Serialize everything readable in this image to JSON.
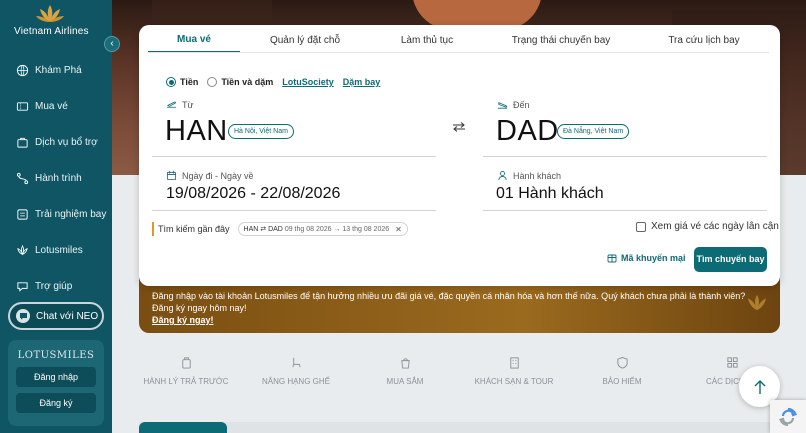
{
  "brand": {
    "name": "Vietnam Airlines",
    "color": "#0f5563",
    "accent": "#0d6b75",
    "gold": "#d79a2b"
  },
  "sidebar": {
    "items": [
      {
        "label": "Khám Phá",
        "icon": "globe-icon"
      },
      {
        "label": "Mua vé",
        "icon": "ticket-icon"
      },
      {
        "label": "Dịch vụ bổ trợ",
        "icon": "services-icon"
      },
      {
        "label": "Hành trình",
        "icon": "route-icon"
      },
      {
        "label": "Trải nghiệm bay",
        "icon": "experience-icon"
      },
      {
        "label": "Lotusmiles",
        "icon": "lotus-icon"
      },
      {
        "label": "Trợ giúp",
        "icon": "help-icon"
      }
    ],
    "chat_label": "Chat với NEO",
    "lotusmiles": {
      "title": "LOTUSMILES",
      "login": "Đăng nhập",
      "register": "Đăng ký"
    }
  },
  "tabs": [
    "Mua vé",
    "Quản lý đặt chỗ",
    "Làm thủ tục",
    "Trạng thái chuyến bay",
    "Tra cứu lịch bay"
  ],
  "options": {
    "cash": "Tiền",
    "cash_miles": "Tiền và dặm",
    "lotus_society": "LotuSociety",
    "miles": "Dặm bay"
  },
  "from": {
    "label": "Từ",
    "code": "HAN",
    "city": "Hà Nội, Việt Nam"
  },
  "to": {
    "label": "Đến",
    "code": "DAD",
    "city": "Đà Nẵng, Việt Nam"
  },
  "dates": {
    "label": "Ngày đi - Ngày về",
    "value": "19/08/2026 - 22/08/2026"
  },
  "passengers": {
    "label": "Hành khách",
    "value": "01 Hành khách"
  },
  "recent": {
    "label": "Tìm kiếm gần đây",
    "chip_route": "HAN ⇄ DAD",
    "chip_dates": "09 thg 08 2026 → 13 thg 08 2026"
  },
  "flex_dates": "Xem giá vé các ngày lân cận",
  "promo": "Mã khuyến mại",
  "search": "Tìm chuyến bay",
  "banner": {
    "message": "Đăng nhập vào tài khoản Lotusmiles để tận hưởng nhiều ưu đãi giá vé, đặc quyền cá nhân hóa và hơn thế nữa. Quý khách chưa phải là thành viên? Đăng ký ngay hôm nay!",
    "link": "Đăng ký ngay!"
  },
  "services": [
    {
      "label": "HÀNH LÝ TRẢ TRƯỚC",
      "icon": "baggage-icon"
    },
    {
      "label": "NÂNG HẠNG GHẾ",
      "icon": "seat-icon"
    },
    {
      "label": "MUA SẮM",
      "icon": "shopping-icon"
    },
    {
      "label": "KHÁCH SẠN & TOUR",
      "icon": "hotel-icon"
    },
    {
      "label": "BẢO HIỂM",
      "icon": "insurance-icon"
    },
    {
      "label": "CÁC DỊCH VỤ",
      "icon": "grid-icon"
    }
  ]
}
